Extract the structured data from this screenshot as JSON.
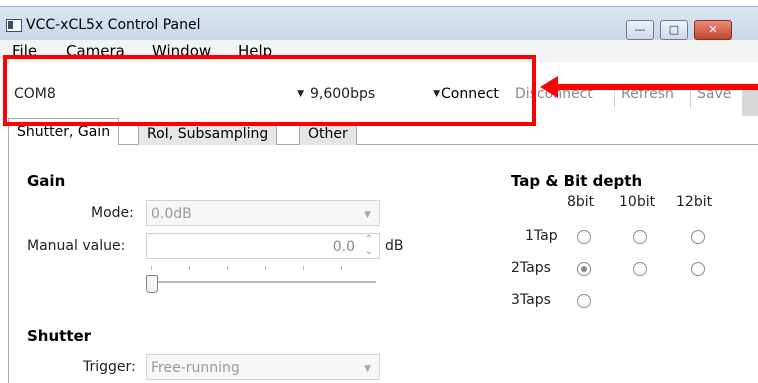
{
  "window": {
    "title": "VCC-xCL5x Control Panel",
    "minimize_label": "—",
    "maximize_label": "□",
    "close_label": "✕"
  },
  "menu": [
    "File",
    "Camera",
    "Window",
    "Help"
  ],
  "toolbar": {
    "port": "COM8",
    "baud": "9,600bps",
    "connect_label": "Connect",
    "disconnect_label": "Disconnect",
    "refresh_label": "Refresh",
    "save_label": "Save"
  },
  "tabs": [
    "Shutter, Gain",
    "RoI, Subsampling",
    "Other"
  ],
  "gain": {
    "heading": "Gain",
    "mode_label": "Mode:",
    "mode_value": "0.0dB",
    "manual_label": "Manual value:",
    "manual_value": "0.0",
    "unit": "dB",
    "slider_level": 0
  },
  "shutter": {
    "heading": "Shutter",
    "trigger_label": "Trigger:",
    "trigger_value": "Free-running"
  },
  "tap": {
    "heading": "Tap & Bit depth",
    "columns": [
      "8bit",
      "10bit",
      "12bit"
    ],
    "rows": [
      "1Tap",
      "2Taps",
      "3Taps"
    ],
    "selected": "2Taps-8bit"
  },
  "icons": {
    "spin": "up-down-icon",
    "dropdown": "chevron-down-icon"
  },
  "colors": {
    "annotation": "#ff0000"
  }
}
